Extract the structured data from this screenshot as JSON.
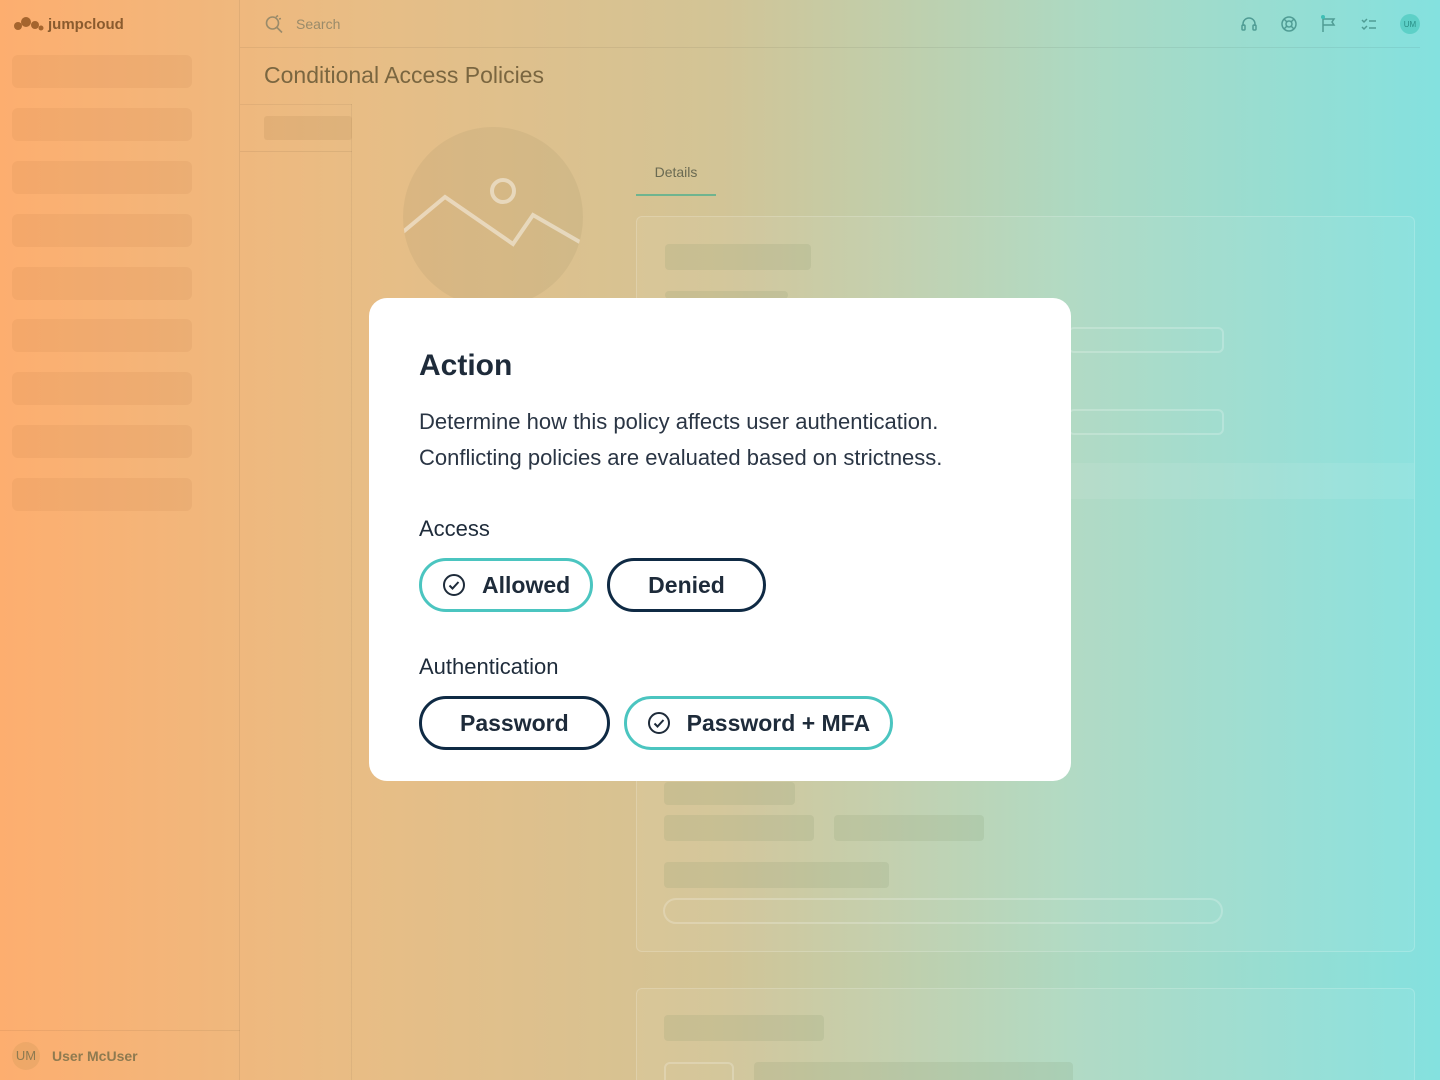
{
  "app": {
    "brand": "jumpcloud"
  },
  "header": {
    "search_placeholder": "Search",
    "avatar_initials": "UM"
  },
  "page": {
    "title": "Conditional Access Policies",
    "tabs": [
      {
        "label": "Details"
      }
    ]
  },
  "user": {
    "initials": "UM",
    "name": "User McUser"
  },
  "modal": {
    "title": "Action",
    "description": "Determine how this policy affects user authentication. Conflicting policies are evaluated based on strictness.",
    "access": {
      "label": "Access",
      "options": [
        {
          "label": "Allowed",
          "selected": true
        },
        {
          "label": "Denied",
          "selected": false
        }
      ]
    },
    "authentication": {
      "label": "Authentication",
      "options": [
        {
          "label": "Password",
          "selected": false
        },
        {
          "label": "Password + MFA",
          "selected": true
        }
      ]
    }
  },
  "colors": {
    "selected_border": "#4bc5c0",
    "default_border": "#0f2a44",
    "text": "#1e2b3a"
  },
  "icons": [
    "cloud-logo-icon",
    "search-icon",
    "headset-icon",
    "help-icon",
    "flag-icon",
    "checklist-icon",
    "check-circle-icon",
    "image-placeholder-icon"
  ]
}
